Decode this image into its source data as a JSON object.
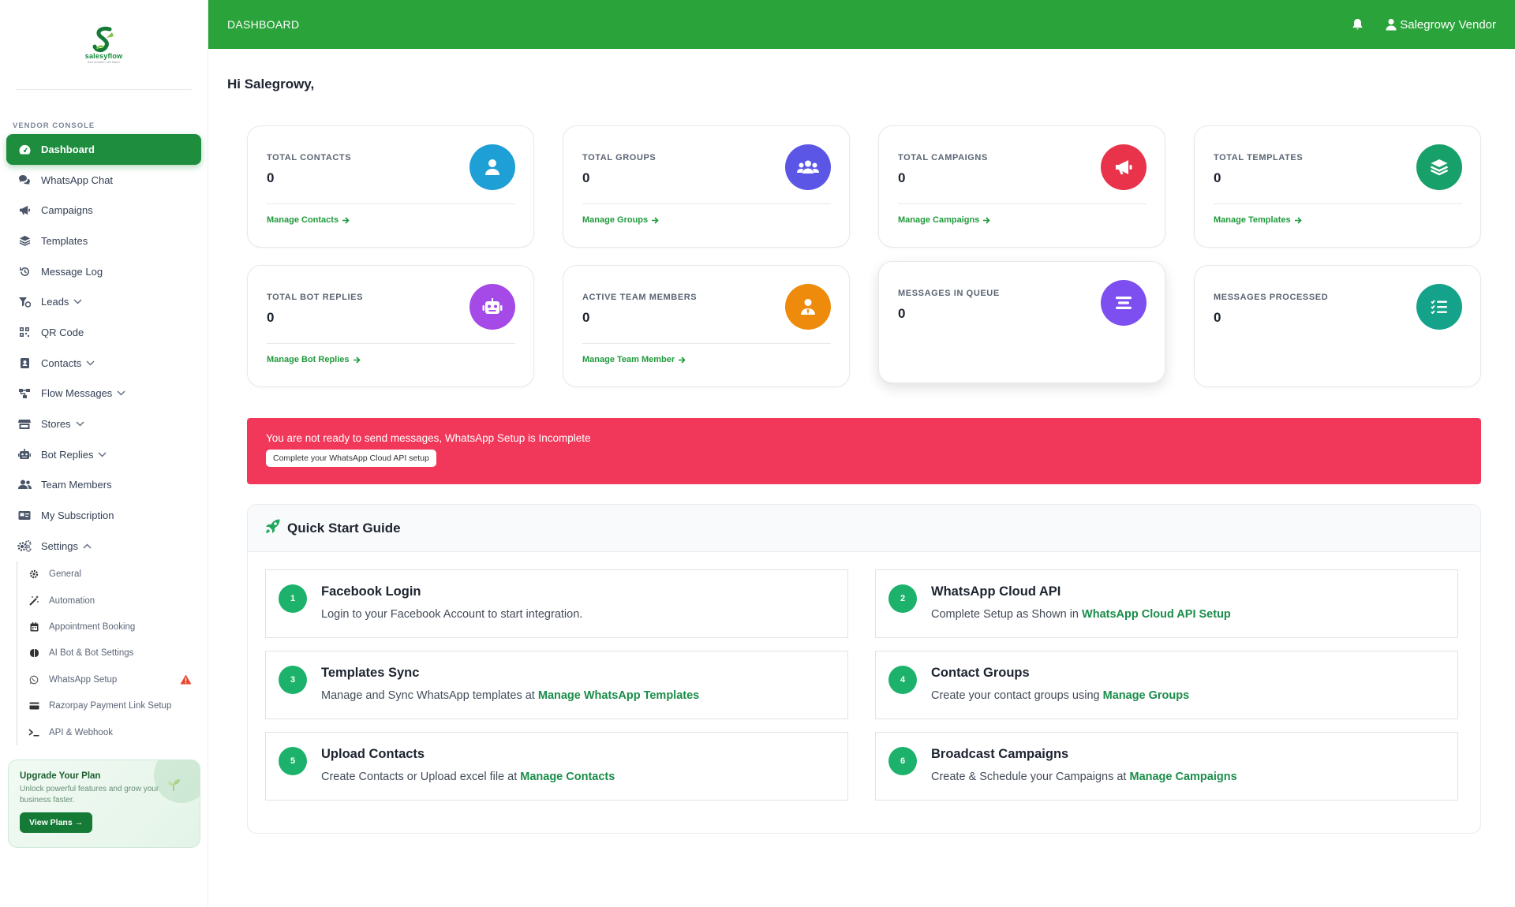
{
  "brand": {
    "name": "salesyflow",
    "tagline": "flow smarter, sell faster"
  },
  "header": {
    "title": "DASHBOARD",
    "user": "Salegrowy Vendor"
  },
  "sidebar": {
    "section": "VENDOR CONSOLE",
    "items": [
      {
        "label": "Dashboard",
        "icon": "dashboard-icon"
      },
      {
        "label": "WhatsApp Chat",
        "icon": "chat-icon"
      },
      {
        "label": "Campaigns",
        "icon": "megaphone-icon"
      },
      {
        "label": "Templates",
        "icon": "layers-icon"
      },
      {
        "label": "Message Log",
        "icon": "history-icon"
      },
      {
        "label": "Leads",
        "icon": "funnel-icon"
      },
      {
        "label": "QR Code",
        "icon": "qr-icon"
      },
      {
        "label": "Contacts",
        "icon": "contact-book-icon"
      },
      {
        "label": "Flow Messages",
        "icon": "flow-icon"
      },
      {
        "label": "Stores",
        "icon": "store-icon"
      },
      {
        "label": "Bot Replies",
        "icon": "robot-icon"
      },
      {
        "label": "Team Members",
        "icon": "users-icon"
      },
      {
        "label": "My Subscription",
        "icon": "subscription-icon"
      },
      {
        "label": "Settings",
        "icon": "gears-icon"
      }
    ],
    "settings_sub": [
      {
        "label": "General",
        "icon": "gear-icon"
      },
      {
        "label": "Automation",
        "icon": "magic-wand-icon"
      },
      {
        "label": "Appointment Booking",
        "icon": "calendar-icon"
      },
      {
        "label": "AI Bot & Bot Settings",
        "icon": "brain-icon"
      },
      {
        "label": "WhatsApp Setup",
        "icon": "whatsapp-icon"
      },
      {
        "label": "Razorpay Payment Link Setup",
        "icon": "credit-card-icon"
      },
      {
        "label": "API & Webhook",
        "icon": "terminal-icon"
      }
    ],
    "upgrade": {
      "title": "Upgrade Your Plan",
      "text": "Unlock powerful features and grow your business faster.",
      "button": "View Plans →"
    }
  },
  "main": {
    "greeting": "Hi Salegrowy,",
    "cards": [
      {
        "label": "TOTAL CONTACTS",
        "value": "0",
        "link": "Manage Contacts",
        "icon": "user-icon",
        "color": "#1e9fd6"
      },
      {
        "label": "TOTAL GROUPS",
        "value": "0",
        "link": "Manage Groups",
        "icon": "users-icon",
        "color": "#5b56e6"
      },
      {
        "label": "TOTAL CAMPAIGNS",
        "value": "0",
        "link": "Manage Campaigns",
        "icon": "megaphone-icon",
        "color": "#e8334b"
      },
      {
        "label": "TOTAL TEMPLATES",
        "value": "0",
        "link": "Manage Templates",
        "icon": "layers-icon",
        "color": "#18a06a"
      },
      {
        "label": "TOTAL BOT REPLIES",
        "value": "0",
        "link": "Manage Bot Replies",
        "icon": "robot-icon",
        "color": "#a54ae6"
      },
      {
        "label": "ACTIVE TEAM MEMBERS",
        "value": "0",
        "link": "Manage Team Member",
        "icon": "user-tie-icon",
        "color": "#ee8b0c"
      },
      {
        "label": "MESSAGES IN QUEUE",
        "value": "0",
        "link": "",
        "icon": "queue-icon",
        "color": "#7d4ff0"
      },
      {
        "label": "MESSAGES PROCESSED",
        "value": "0",
        "link": "",
        "icon": "list-check-icon",
        "color": "#14a38a"
      }
    ],
    "alert": {
      "text": "You are not ready to send messages, WhatsApp Setup is Incomplete",
      "button": "Complete your WhatsApp Cloud API setup"
    },
    "guide": {
      "title": "Quick Start Guide",
      "steps": [
        {
          "num": "1",
          "title": "Facebook Login",
          "desc": "Login to your Facebook Account to start integration.",
          "link": ""
        },
        {
          "num": "2",
          "title": "WhatsApp Cloud API",
          "desc": "Complete Setup as Shown in ",
          "link": "WhatsApp Cloud API Setup"
        },
        {
          "num": "3",
          "title": "Templates Sync",
          "desc": "Manage and Sync WhatsApp templates at ",
          "link": "Manage WhatsApp Templates"
        },
        {
          "num": "4",
          "title": "Contact Groups",
          "desc": "Create your contact groups using ",
          "link": "Manage Groups"
        },
        {
          "num": "5",
          "title": "Upload Contacts",
          "desc": "Create Contacts or Upload excel file at ",
          "link": "Manage Contacts"
        },
        {
          "num": "6",
          "title": "Broadcast Campaigns",
          "desc": "Create & Schedule your Campaigns at ",
          "link": "Manage Campaigns"
        }
      ]
    }
  }
}
